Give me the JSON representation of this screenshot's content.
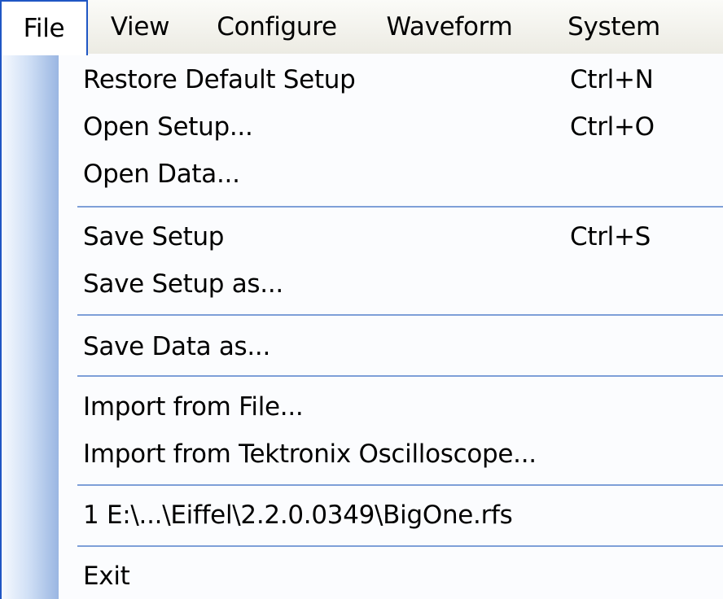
{
  "menubar": {
    "items": [
      {
        "label": "File",
        "active": true
      },
      {
        "label": "View"
      },
      {
        "label": "Configure"
      },
      {
        "label": "Waveform"
      },
      {
        "label": "System"
      }
    ]
  },
  "file_menu": {
    "groups": [
      [
        {
          "label": "Restore Default Setup",
          "shortcut": "Ctrl+N"
        },
        {
          "label": "Open Setup...",
          "shortcut": "Ctrl+O"
        },
        {
          "label": "Open Data..."
        }
      ],
      [
        {
          "label": "Save Setup",
          "shortcut": "Ctrl+S"
        },
        {
          "label": "Save Setup as..."
        }
      ],
      [
        {
          "label": "Save Data as..."
        }
      ],
      [
        {
          "label": "Import from File..."
        },
        {
          "label": "Import from Tektronix Oscilloscope..."
        }
      ],
      [
        {
          "label": "1 E:\\...\\Eiffel\\2.2.0.0349\\BigOne.rfs"
        }
      ],
      [
        {
          "label": "Exit"
        }
      ]
    ]
  },
  "colors": {
    "selection_border": "#1f56c4",
    "separator": "#7e9fd8",
    "gutter_dark": "#9ab6e2"
  }
}
